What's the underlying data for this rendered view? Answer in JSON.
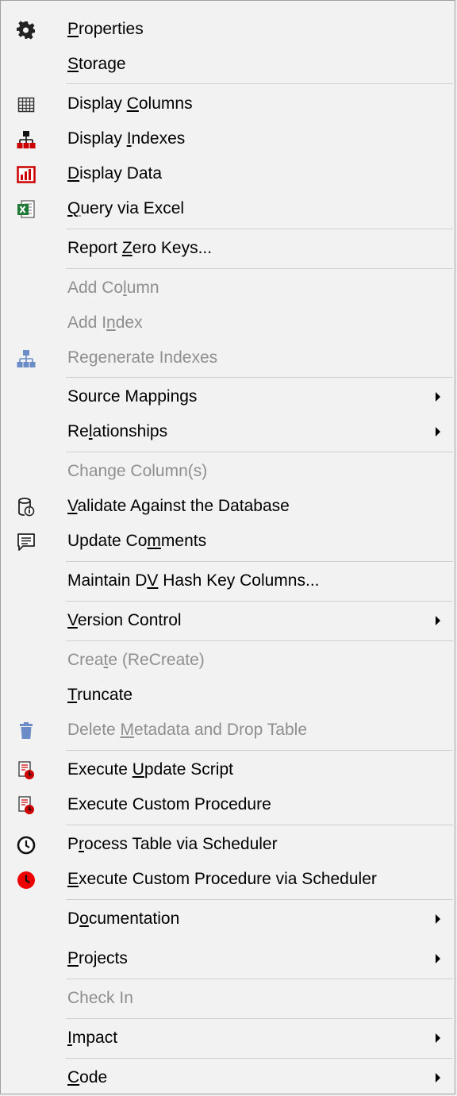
{
  "menu": {
    "items": [
      {
        "pre": "",
        "mn": "P",
        "post": "roperties",
        "icon": "gear-icon",
        "disabled": false,
        "submenu": false
      },
      {
        "pre": "",
        "mn": "S",
        "post": "torage",
        "icon": "",
        "disabled": false,
        "submenu": false
      },
      {
        "pre": "Display ",
        "mn": "C",
        "post": "olumns",
        "icon": "grid-icon",
        "disabled": false,
        "submenu": false
      },
      {
        "pre": "Display ",
        "mn": "I",
        "post": "ndexes",
        "icon": "hierarchy-icon",
        "disabled": false,
        "submenu": false
      },
      {
        "pre": "",
        "mn": "D",
        "post": "isplay Data",
        "icon": "bar-chart-icon",
        "disabled": false,
        "submenu": false
      },
      {
        "pre": "",
        "mn": "Q",
        "post": "uery via Excel",
        "icon": "excel-icon",
        "disabled": false,
        "submenu": false
      },
      {
        "pre": "Report ",
        "mn": "Z",
        "post": "ero Keys...",
        "icon": "",
        "disabled": false,
        "submenu": false
      },
      {
        "pre": "Add Co",
        "mn": "l",
        "post": "umn",
        "icon": "",
        "disabled": true,
        "submenu": false
      },
      {
        "pre": "Add I",
        "mn": "n",
        "post": "dex",
        "icon": "",
        "disabled": true,
        "submenu": false
      },
      {
        "pre": "Regenerate Indexes",
        "mn": "",
        "post": "",
        "icon": "hierarchy-disabled-icon",
        "disabled": true,
        "submenu": false
      },
      {
        "pre": "Source Mappings",
        "mn": "",
        "post": "",
        "icon": "",
        "disabled": false,
        "submenu": true
      },
      {
        "pre": "Re",
        "mn": "l",
        "post": "ationships",
        "icon": "",
        "disabled": false,
        "submenu": true
      },
      {
        "pre": "Chan",
        "mn": "g",
        "post": "e Column(s)",
        "icon": "",
        "disabled": true,
        "submenu": false
      },
      {
        "pre": "",
        "mn": "V",
        "post": "alidate Against the Database",
        "icon": "database-info-icon",
        "disabled": false,
        "submenu": false
      },
      {
        "pre": "Update Co",
        "mn": "m",
        "post": "ments",
        "icon": "comment-icon",
        "disabled": false,
        "submenu": false
      },
      {
        "pre": "Maintain D",
        "mn": "V",
        "post": " Hash Key Columns...",
        "icon": "",
        "disabled": false,
        "submenu": false
      },
      {
        "pre": "",
        "mn": "V",
        "post": "ersion Control",
        "icon": "",
        "disabled": false,
        "submenu": true
      },
      {
        "pre": "Crea",
        "mn": "t",
        "post": "e (ReCreate)",
        "icon": "",
        "disabled": true,
        "submenu": false
      },
      {
        "pre": "",
        "mn": "T",
        "post": "runcate",
        "icon": "",
        "disabled": false,
        "submenu": false
      },
      {
        "pre": "Delete ",
        "mn": "M",
        "post": "etadata and Drop Table",
        "icon": "trash-icon",
        "disabled": true,
        "submenu": false
      },
      {
        "pre": "Execute ",
        "mn": "U",
        "post": "pdate Script",
        "icon": "script-run-icon",
        "disabled": false,
        "submenu": false
      },
      {
        "pre": "Execute Custom Procedure",
        "mn": "",
        "post": "",
        "icon": "script-run-icon",
        "disabled": false,
        "submenu": false
      },
      {
        "pre": "P",
        "mn": "r",
        "post": "ocess Table via Scheduler",
        "icon": "clock-icon",
        "disabled": false,
        "submenu": false
      },
      {
        "pre": "",
        "mn": "E",
        "post": "xecute Custom Procedure via Scheduler",
        "icon": "clock-red-icon",
        "disabled": false,
        "submenu": false
      },
      {
        "pre": "D",
        "mn": "o",
        "post": "cumentation",
        "icon": "",
        "disabled": false,
        "submenu": true
      },
      {
        "pre": "",
        "mn": "P",
        "post": "rojects",
        "icon": "",
        "disabled": false,
        "submenu": true
      },
      {
        "pre": "Check In",
        "mn": "",
        "post": "",
        "icon": "",
        "disabled": true,
        "submenu": false
      },
      {
        "pre": "",
        "mn": "I",
        "post": "mpact",
        "icon": "",
        "disabled": false,
        "submenu": true
      },
      {
        "pre": "",
        "mn": "C",
        "post": "ode",
        "icon": "",
        "disabled": false,
        "submenu": true
      }
    ]
  }
}
